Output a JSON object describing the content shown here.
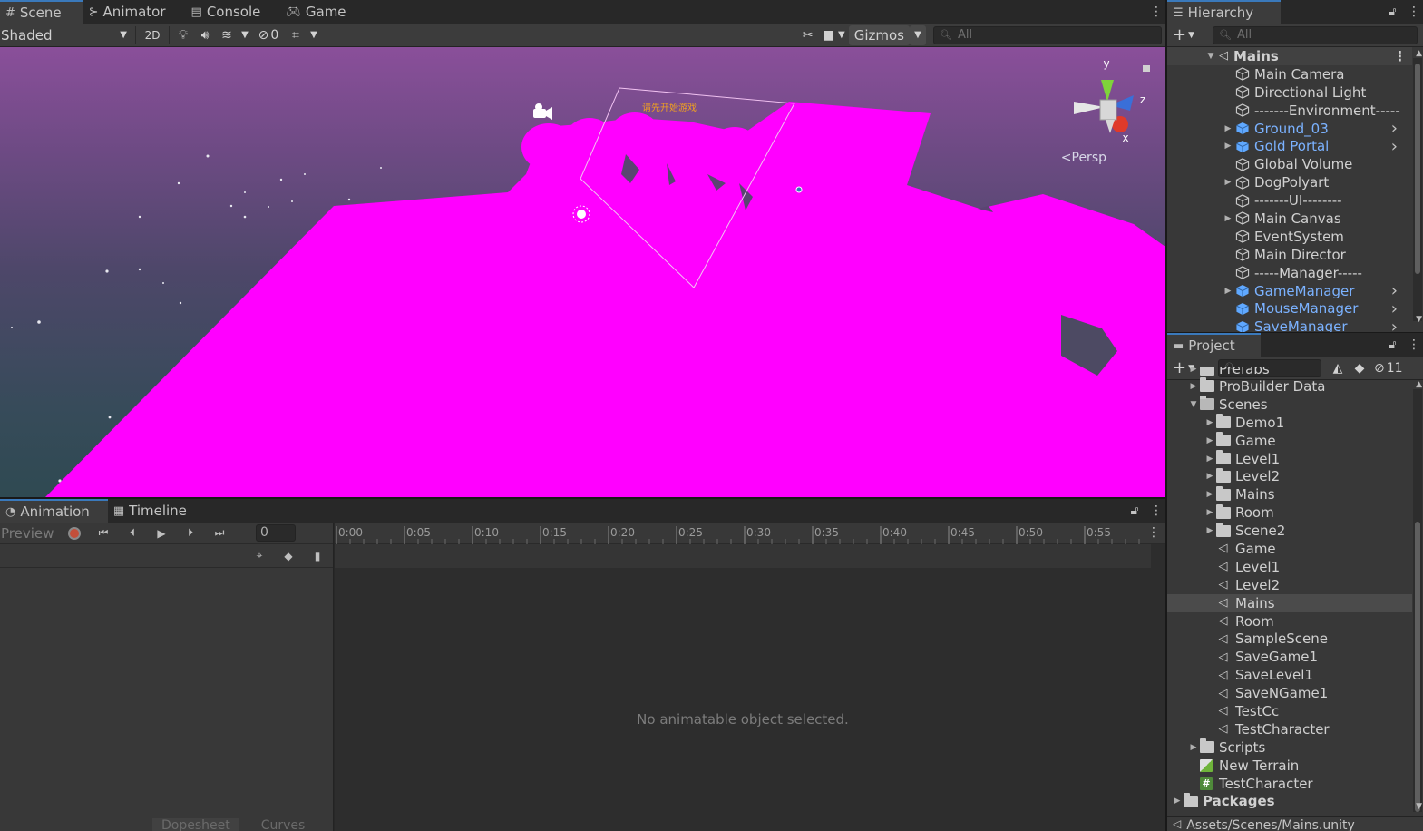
{
  "scene_panel": {
    "tabs": [
      {
        "label": "Scene",
        "icon": "grid-icon",
        "active": true
      },
      {
        "label": "Animator",
        "icon": "animator-icon",
        "active": false
      },
      {
        "label": "Console",
        "icon": "console-icon",
        "active": false
      },
      {
        "label": "Game",
        "icon": "gamepad-icon",
        "active": false
      }
    ],
    "shading_mode": "Shaded",
    "btn_2d": "2D",
    "hidden_count": "0",
    "gizmos_label": "Gizmos",
    "search_placeholder": "All",
    "projection_label": "Persp",
    "axis_labels": {
      "y": "y",
      "z": "z",
      "x": "x"
    },
    "sign_text": "请先开始游戏"
  },
  "hierarchy": {
    "title": "Hierarchy",
    "search_placeholder": "All",
    "scene_name": "Mains",
    "items": [
      {
        "label": "Main Camera",
        "expandable": false,
        "prefab": false
      },
      {
        "label": "Directional Light",
        "expandable": false,
        "prefab": false
      },
      {
        "label": "-------Environment-----",
        "expandable": false,
        "prefab": false
      },
      {
        "label": "Ground_03",
        "expandable": true,
        "prefab": true
      },
      {
        "label": "Gold Portal",
        "expandable": true,
        "prefab": true
      },
      {
        "label": "Global Volume",
        "expandable": false,
        "prefab": false
      },
      {
        "label": "DogPolyart",
        "expandable": true,
        "prefab": false
      },
      {
        "label": "-------UI--------",
        "expandable": false,
        "prefab": false
      },
      {
        "label": "Main Canvas",
        "expandable": true,
        "prefab": false
      },
      {
        "label": "EventSystem",
        "expandable": false,
        "prefab": false
      },
      {
        "label": "Main Director",
        "expandable": false,
        "prefab": false
      },
      {
        "label": "-----Manager-----",
        "expandable": false,
        "prefab": false
      },
      {
        "label": "GameManager",
        "expandable": true,
        "prefab": true
      },
      {
        "label": "MouseManager",
        "expandable": false,
        "prefab": true
      },
      {
        "label": "SaveManager",
        "expandable": false,
        "prefab": true
      }
    ]
  },
  "project": {
    "title": "Project",
    "hidden_count": "11",
    "clipped_item": "Prefabs",
    "items": [
      {
        "label": "ProBuilder Data",
        "type": "folder",
        "indent": 1,
        "arrow": "right"
      },
      {
        "label": "Scenes",
        "type": "folder-open",
        "indent": 1,
        "arrow": "down"
      },
      {
        "label": "Demo1",
        "type": "folder",
        "indent": 2,
        "arrow": "right"
      },
      {
        "label": "Game",
        "type": "folder",
        "indent": 2,
        "arrow": "right"
      },
      {
        "label": "Level1",
        "type": "folder",
        "indent": 2,
        "arrow": "right"
      },
      {
        "label": "Level2",
        "type": "folder",
        "indent": 2,
        "arrow": "right"
      },
      {
        "label": "Mains",
        "type": "folder",
        "indent": 2,
        "arrow": "right"
      },
      {
        "label": "Room",
        "type": "folder",
        "indent": 2,
        "arrow": "right"
      },
      {
        "label": "Scene2",
        "type": "folder",
        "indent": 2,
        "arrow": "right"
      },
      {
        "label": "Game",
        "type": "scene",
        "indent": 2,
        "arrow": ""
      },
      {
        "label": "Level1",
        "type": "scene",
        "indent": 2,
        "arrow": ""
      },
      {
        "label": "Level2",
        "type": "scene",
        "indent": 2,
        "arrow": ""
      },
      {
        "label": "Mains",
        "type": "scene",
        "indent": 2,
        "arrow": "",
        "selected": true
      },
      {
        "label": "Room",
        "type": "scene",
        "indent": 2,
        "arrow": ""
      },
      {
        "label": "SampleScene",
        "type": "scene",
        "indent": 2,
        "arrow": ""
      },
      {
        "label": "SaveGame1",
        "type": "scene",
        "indent": 2,
        "arrow": ""
      },
      {
        "label": "SaveLevel1",
        "type": "scene",
        "indent": 2,
        "arrow": ""
      },
      {
        "label": "SaveNGame1",
        "type": "scene",
        "indent": 2,
        "arrow": ""
      },
      {
        "label": "TestCc",
        "type": "scene",
        "indent": 2,
        "arrow": ""
      },
      {
        "label": "TestCharacter",
        "type": "scene",
        "indent": 2,
        "arrow": ""
      },
      {
        "label": "Scripts",
        "type": "folder",
        "indent": 1,
        "arrow": "right"
      },
      {
        "label": "New Terrain",
        "type": "terrain",
        "indent": 1,
        "arrow": ""
      },
      {
        "label": "TestCharacter",
        "type": "script",
        "indent": 1,
        "arrow": ""
      },
      {
        "label": "Packages",
        "type": "folder",
        "indent": 0,
        "arrow": "right",
        "bold": true
      }
    ],
    "footer_path": "Assets/Scenes/Mains.unity"
  },
  "animation": {
    "tabs": [
      {
        "label": "Animation",
        "icon": "animation-icon",
        "active": true
      },
      {
        "label": "Timeline",
        "icon": "timeline-icon",
        "active": false
      }
    ],
    "preview_label": "Preview",
    "frame_value": "0",
    "time_ticks": [
      "0:00",
      "0:05",
      "0:10",
      "0:15",
      "0:20",
      "0:25",
      "0:30",
      "0:35",
      "0:40",
      "0:45",
      "0:50",
      "0:55"
    ],
    "empty_message": "No animatable object selected.",
    "bottom_tabs": [
      "Dopesheet",
      "Curves"
    ]
  },
  "colors": {
    "accent": "#3a79bb",
    "prefab_text": "#7bb2ff",
    "missing_material": "#ff00ff",
    "record_red": "#c24f3a"
  }
}
